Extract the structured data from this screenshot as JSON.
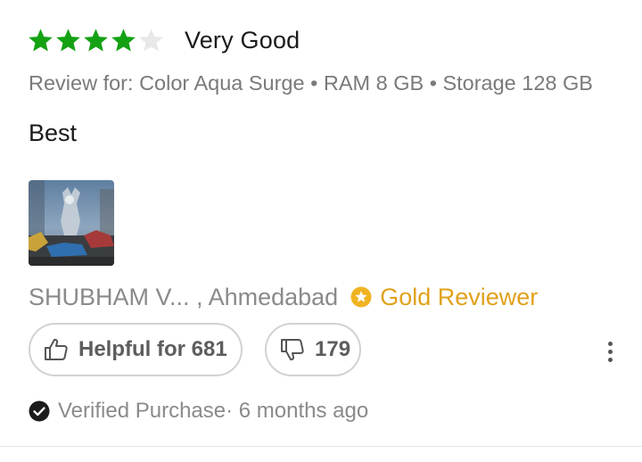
{
  "review": {
    "rating": 4,
    "max_rating": 5,
    "rating_label": "Very Good",
    "variant_text": "Review for: Color Aqua Surge • RAM 8 GB • Storage 128 GB",
    "title": "Best",
    "author_location": "SHUBHAM V... , Ahmedabad",
    "badge_label": "Gold Reviewer",
    "helpful_label": "Helpful for 681",
    "unhelpful_count": "179",
    "verified_text": "Verified Purchase· 6 months ago"
  },
  "icons": {
    "star_filled": "star-icon",
    "star_empty": "star-empty-icon",
    "badge": "gold-star-badge-icon",
    "thumbs_up": "thumbs-up-icon",
    "thumbs_down": "thumbs-down-icon",
    "more": "more-vertical-icon",
    "verified": "check-circle-icon"
  },
  "colors": {
    "star_filled": "#14a214",
    "star_empty": "#e8e8e8",
    "badge": "#e0a11b",
    "muted_text": "#8a8a8a",
    "button_border": "#d2d2d2"
  }
}
